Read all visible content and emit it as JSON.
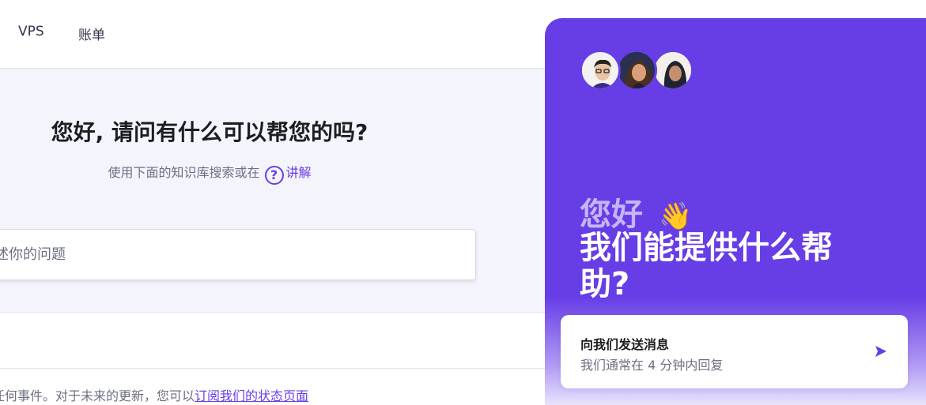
{
  "nav": {
    "items": [
      "VPS",
      "账单"
    ]
  },
  "hero": {
    "title": "您好, 请问有什么可以帮您的吗?",
    "subtitle": "使用下面的知识库搜索或在",
    "help_icon_glyph": "?",
    "explain_link": "讲解",
    "search_placeholder": "描述你的问题"
  },
  "bottom": {
    "text": "任何事件。对于未来的更新，您可以",
    "link": "订阅我们的状态页面"
  },
  "chat": {
    "greeting": "您好",
    "wave_emoji": "👋",
    "question": "我们能提供什么帮助?",
    "card": {
      "title": "向我们发送消息",
      "subtitle": "我们通常在 4 分钟内回复"
    },
    "send_icon": "send-icon"
  },
  "colors": {
    "brand": "#673de6",
    "hero_bg": "#f4f4fd",
    "text": "#1d1e20",
    "muted": "#6d7081"
  }
}
